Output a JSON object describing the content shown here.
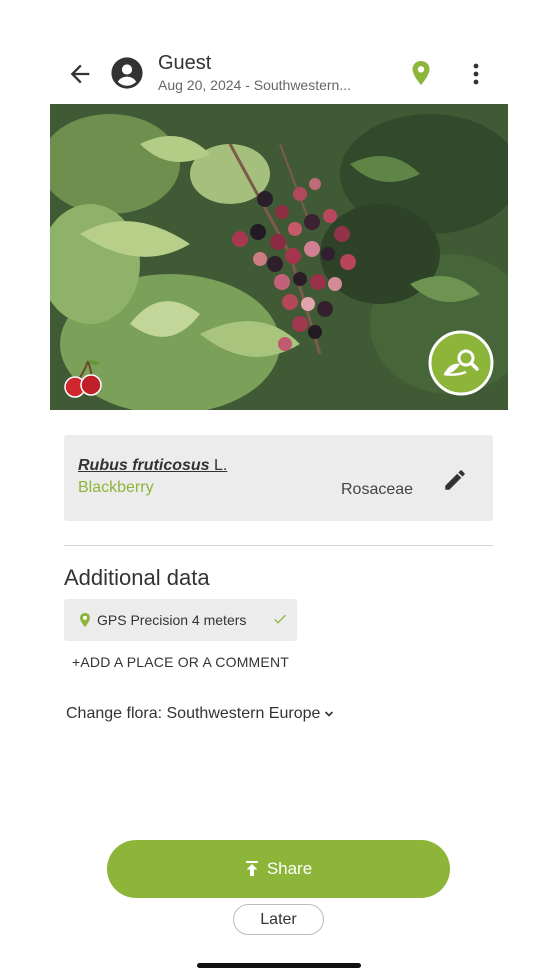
{
  "header": {
    "user_name": "Guest",
    "subtitle": "Aug 20, 2024 - Southwestern..."
  },
  "species": {
    "scientific_name": "Rubus fruticosus",
    "author": "L.",
    "common_name": "Blackberry",
    "family": "Rosaceae"
  },
  "additional": {
    "title": "Additional data",
    "gps_text": "GPS Precision 4 meters",
    "add_place_label": "ADD A PLACE OR A COMMENT",
    "change_flora_label": "Change flora: Southwestern Europe"
  },
  "actions": {
    "share_label": "Share",
    "later_label": "Later"
  },
  "colors": {
    "accent": "#8cb53a",
    "card_bg": "#ececec"
  },
  "icons": [
    "back-arrow-icon",
    "account-icon",
    "location-pin-icon",
    "more-vert-icon",
    "cherry-icon",
    "identify-icon",
    "edit-pencil-icon",
    "check-icon",
    "chevron-down-icon",
    "share-upload-icon"
  ]
}
